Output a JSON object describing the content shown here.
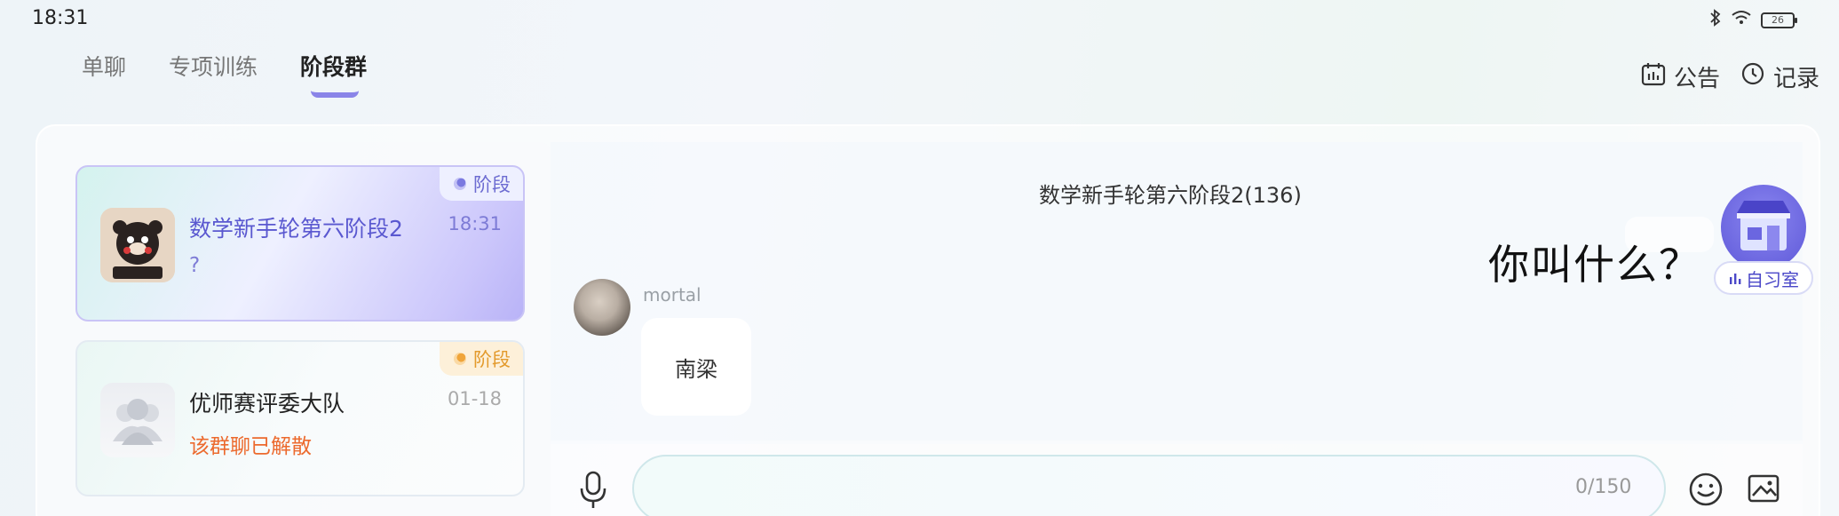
{
  "status_bar": {
    "time": "18:31",
    "battery": "26",
    "icons": [
      "bluetooth-icon",
      "wifi-icon",
      "battery-icon"
    ]
  },
  "tabs": [
    {
      "label": "单聊",
      "active": false
    },
    {
      "label": "专项训练",
      "active": false
    },
    {
      "label": "阶段群",
      "active": true
    }
  ],
  "top_actions": [
    {
      "label": "公告",
      "icon": "calendar-icon"
    },
    {
      "label": "记录",
      "icon": "clock-icon"
    }
  ],
  "groups": [
    {
      "name": "数学新手轮第六阶段2",
      "time": "18:31",
      "last_message": "?",
      "badge": "阶段",
      "selected": true,
      "accent": "#6c6bd1"
    },
    {
      "name": "优师赛评委大队",
      "time": "01-18",
      "last_message": "该群聊已解散",
      "badge": "阶段",
      "selected": false,
      "accent": "#e39a2c"
    }
  ],
  "chat": {
    "title": "数学新手轮第六阶段2(136)",
    "messages": [
      {
        "sender": "mortal",
        "text": "南梁"
      }
    ],
    "floating_message": "你叫什么？",
    "study_room_label": "自习室"
  },
  "input": {
    "value": "",
    "char_count": "0/150"
  },
  "colors": {
    "accent_purple": "#6c6bd1",
    "badge_orange": "#e39a2c",
    "dissolved_red": "#ec6a2e"
  }
}
